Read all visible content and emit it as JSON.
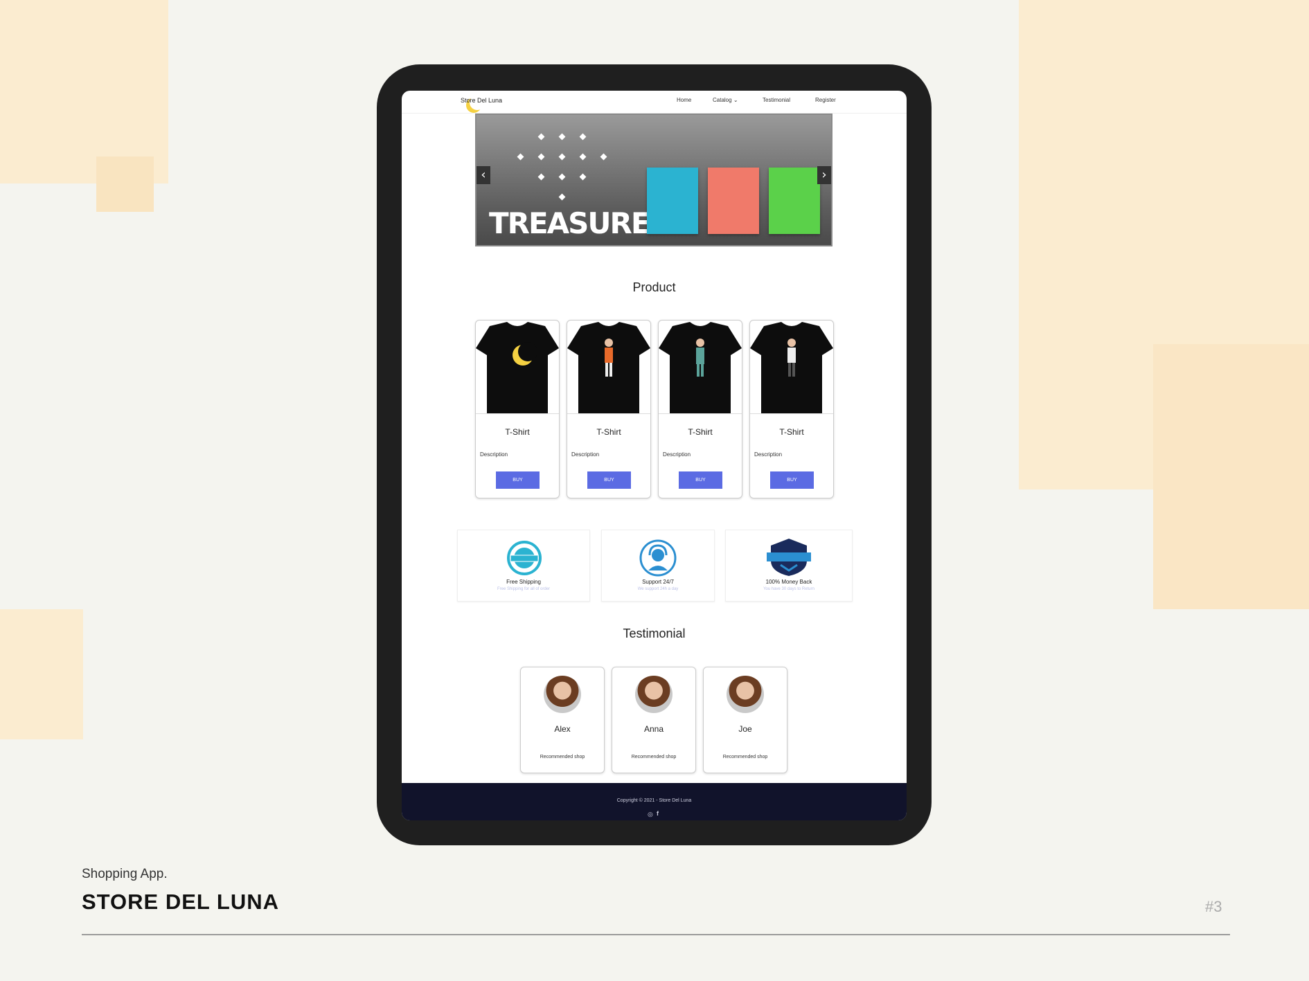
{
  "caption": {
    "category": "Shopping App.",
    "title": "STORE DEL LUNA",
    "page": "#3"
  },
  "nav": {
    "logo": "Store Del Luna",
    "links": [
      "Home",
      "Catalog",
      "Testimonial",
      "Register"
    ]
  },
  "banner": {
    "title": "TREASURE",
    "album_colors": [
      "#2bb3d1",
      "#f07a6a",
      "#5bd14a"
    ]
  },
  "product": {
    "heading": "Product",
    "items": [
      {
        "name": "T-Shirt",
        "desc": "Description",
        "buy": "BUY"
      },
      {
        "name": "T-Shirt",
        "desc": "Description",
        "buy": "BUY"
      },
      {
        "name": "T-Shirt",
        "desc": "Description",
        "buy": "BUY"
      },
      {
        "name": "T-Shirt",
        "desc": "Description",
        "buy": "BUY"
      }
    ]
  },
  "features": [
    {
      "title": "Free Shipping",
      "sub": "Free Shipping for all of order"
    },
    {
      "title": "Support 24/7",
      "sub": "We support 24h a day"
    },
    {
      "title": "100% Money Back",
      "sub": "You have 30 days to Return"
    }
  ],
  "testimonial": {
    "heading": "Testimonial",
    "items": [
      {
        "name": "Alex",
        "text": "Recommended shop"
      },
      {
        "name": "Anna",
        "text": "Recommended shop"
      },
      {
        "name": "Joe",
        "text": "Recommended shop"
      }
    ]
  },
  "footer": {
    "copyright": "Copyright © 2021 - Store Del Luna"
  },
  "colors": {
    "background": "#f4f4ef",
    "accent_block": "#fbecd0",
    "buy_button": "#5b6be3",
    "footer": "#11132b"
  }
}
